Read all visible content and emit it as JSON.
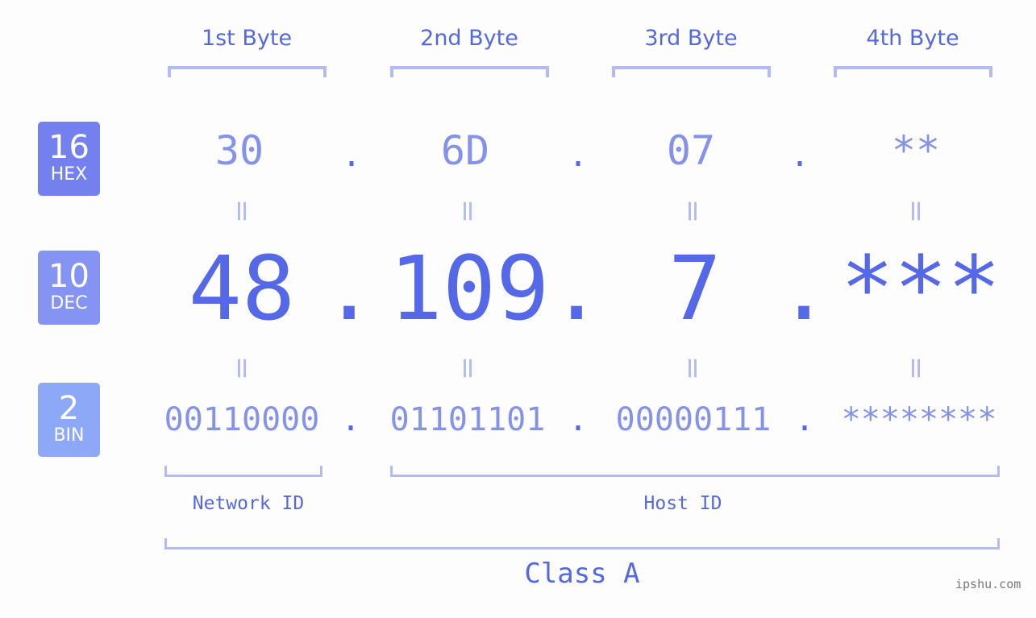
{
  "byte_headers": [
    "1st Byte",
    "2nd Byte",
    "3rd Byte",
    "4th Byte"
  ],
  "badges": [
    {
      "num": "16",
      "label": "HEX",
      "color": "#7480ed"
    },
    {
      "num": "10",
      "label": "DEC",
      "color": "#8593f2"
    },
    {
      "num": "2",
      "label": "BIN",
      "color": "#8ea8f8"
    }
  ],
  "hex": [
    "30",
    "6D",
    "07",
    "**"
  ],
  "dec": [
    "48",
    "109",
    "7",
    "***"
  ],
  "bin": [
    "00110000",
    "01101101",
    "00000111",
    "********"
  ],
  "separator": ".",
  "equals_glyph": "=",
  "network_label": "Network ID",
  "host_label": "Host ID",
  "class_label": "Class A",
  "watermark": "ipshu.com",
  "colors": {
    "accent": "#5468e8",
    "light_accent": "#8592ec",
    "bracket": "#b2bbf6",
    "background": "#fcfdfc"
  }
}
